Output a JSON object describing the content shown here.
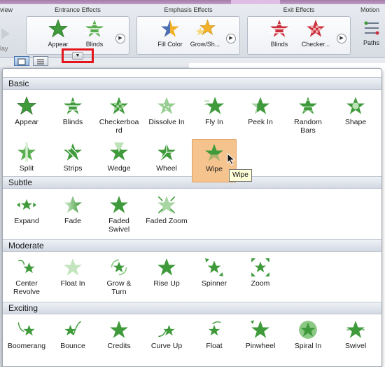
{
  "ribbon": {
    "left_fragment_label": "view",
    "play_label": "lay",
    "groups": [
      {
        "label": "Entrance Effects",
        "items": [
          "Appear",
          "Blinds"
        ]
      },
      {
        "label": "Emphasis Effects",
        "items": [
          "Fill Color",
          "Grow/Sh..."
        ]
      },
      {
        "label": "Exit Effects",
        "items": [
          "Blinds",
          "Checker..."
        ]
      },
      {
        "label": "Motion",
        "items": [
          "Paths"
        ]
      }
    ]
  },
  "dropdown_arrow": "▼",
  "gallery": {
    "sections": [
      {
        "title": "Basic"
      },
      {
        "title": "Subtle"
      },
      {
        "title": "Moderate"
      },
      {
        "title": "Exciting"
      }
    ],
    "basic": [
      "Appear",
      "Blinds",
      "Checkerboa\nrd",
      "Dissolve In",
      "Fly In",
      "Peek In",
      "Random\nBars",
      "Shape",
      "Split",
      "Strips",
      "Wedge",
      "Wheel",
      "Wipe"
    ],
    "subtle": [
      "Expand",
      "Fade",
      "Faded\nSwivel",
      "Faded Zoom"
    ],
    "moderate": [
      "Center\nRevolve",
      "Float In",
      "Grow &\nTurn",
      "Rise Up",
      "Spinner",
      "Zoom"
    ],
    "exciting": [
      "Boomerang",
      "Bounce",
      "Credits",
      "Curve Up",
      "Float",
      "Pinwheel",
      "Spiral In",
      "Swivel"
    ],
    "selected": "Wipe",
    "tooltip": "Wipe"
  },
  "colors": {
    "star_green": "#3e9a3a",
    "selection": "#f5c38e",
    "highlight_box": "#e3161e"
  }
}
